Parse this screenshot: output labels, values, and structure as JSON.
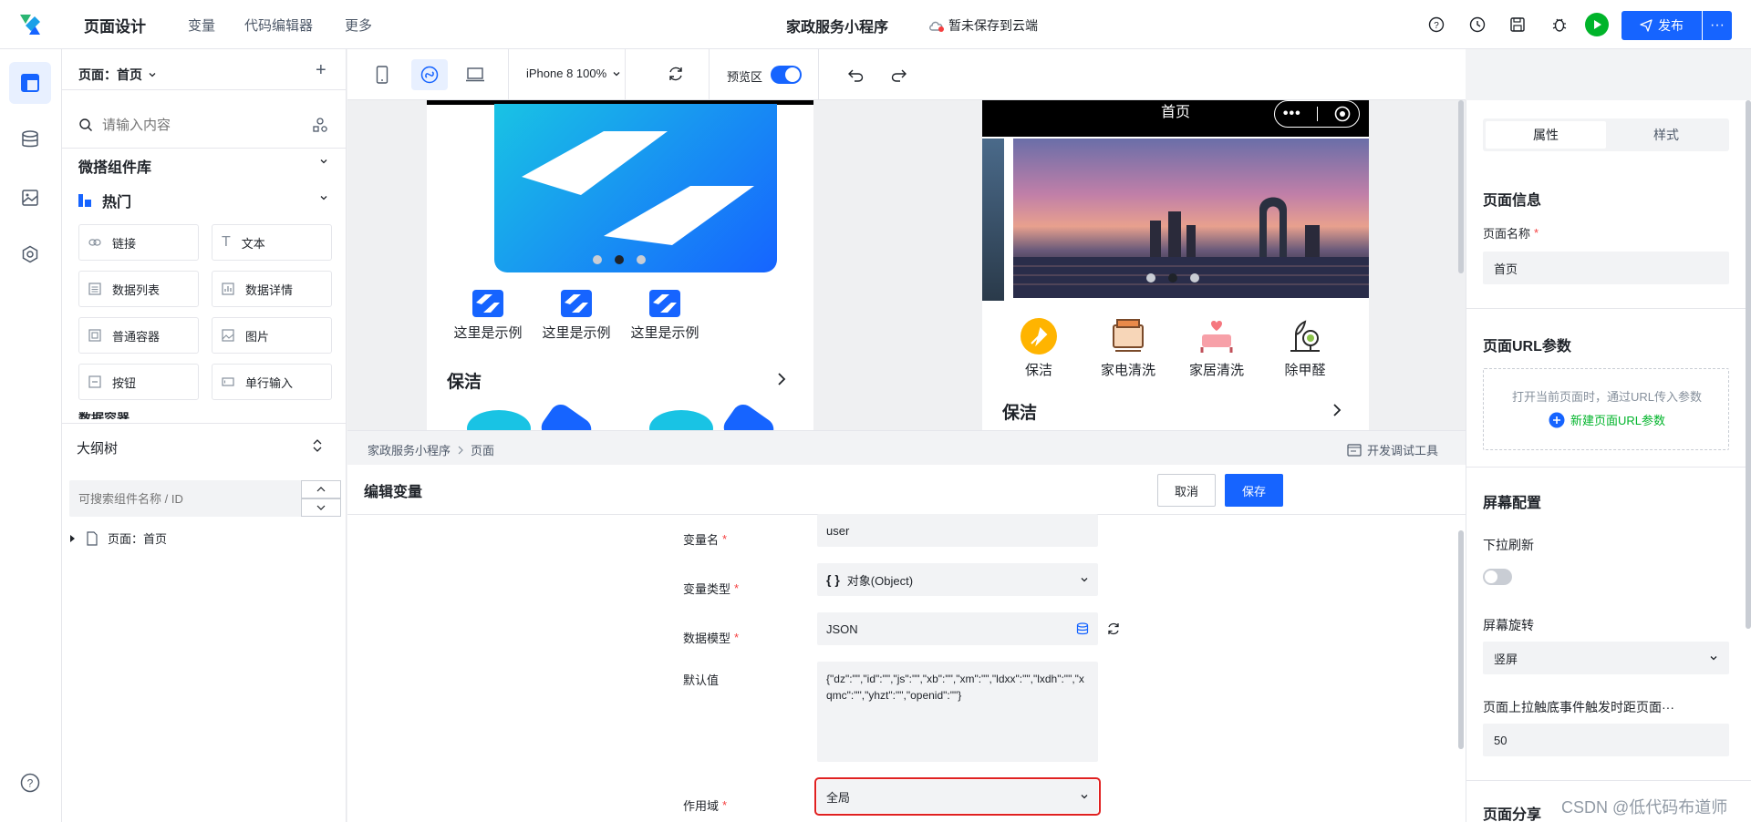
{
  "topbar": {
    "nav": [
      "页面设计",
      "变量",
      "代码编辑器",
      "更多"
    ],
    "app_title": "家政服务小程序",
    "save_status": "暂未保存到云端",
    "publish_label": "发布",
    "more_label": "···"
  },
  "component_panel": {
    "page_selector": "页面：首页",
    "add_label": "+",
    "search_placeholder": "请输入内容",
    "library_title": "微搭组件库",
    "hot_title": "热门",
    "components": [
      "链接",
      "文本",
      "数据列表",
      "数据详情",
      "普通容器",
      "图片",
      "按钮",
      "单行输入"
    ],
    "truncated_next": "数据容器"
  },
  "outline_panel": {
    "title": "大纲树",
    "search_placeholder": "可搜索组件名称 / ID",
    "tree_root": "页面：首页"
  },
  "canvas_toolbar": {
    "device": "iPhone 8 100%",
    "preview_label": "预览区",
    "preview_on": true
  },
  "preview_left": {
    "examples": [
      "这里是示例",
      "这里是示例",
      "这里是示例"
    ],
    "section_title": "保洁"
  },
  "preview_right": {
    "nav_title": "首页",
    "services": [
      "保洁",
      "家电清洗",
      "家居清洗",
      "除甲醛"
    ],
    "section_title": "保洁"
  },
  "breadcrumb": {
    "items": [
      "家政服务小程序",
      "页面"
    ],
    "devtools_label": "开发调试工具"
  },
  "editor": {
    "title": "编辑变量",
    "cancel_label": "取消",
    "save_label": "保存",
    "fields": {
      "name_label": "变量名",
      "name_value": "user",
      "type_label": "变量类型",
      "type_value": "对象(Object)",
      "type_icon": "{ }",
      "model_label": "数据模型",
      "model_value": "JSON",
      "default_label": "默认值",
      "default_value": "{\"dz\":\"\",\"id\":\"\",\"js\":\"\",\"xb\":\"\",\"xm\":\"\",\"ldxx\":\"\",\"lxdh\":\"\",\"xqmc\":\"\",\"yhzt\":\"\",\"openid\":\"\"}",
      "scope_label": "作用域",
      "scope_value": "全局"
    }
  },
  "right_panel": {
    "tabs": [
      "属性",
      "样式"
    ],
    "active_tab": "属性",
    "page_info_title": "页面信息",
    "page_name_label": "页面名称",
    "page_name_value": "首页",
    "url_params_title": "页面URL参数",
    "url_params_hint": "打开当前页面时，通过URL传入参数",
    "url_params_add": "新建页面URL参数",
    "screen_title": "屏幕配置",
    "pull_refresh_label": "下拉刷新",
    "pull_refresh_on": false,
    "rotation_label": "屏幕旋转",
    "rotation_value": "竖屏",
    "reach_bottom_label": "页面上拉触底事件触发时距页面···",
    "reach_bottom_value": "50",
    "share_title": "页面分享"
  },
  "watermark": "CSDN @低代码布道师",
  "colors": {
    "primary": "#1664ff",
    "danger": "#f53f3f",
    "success": "#00b42a"
  }
}
